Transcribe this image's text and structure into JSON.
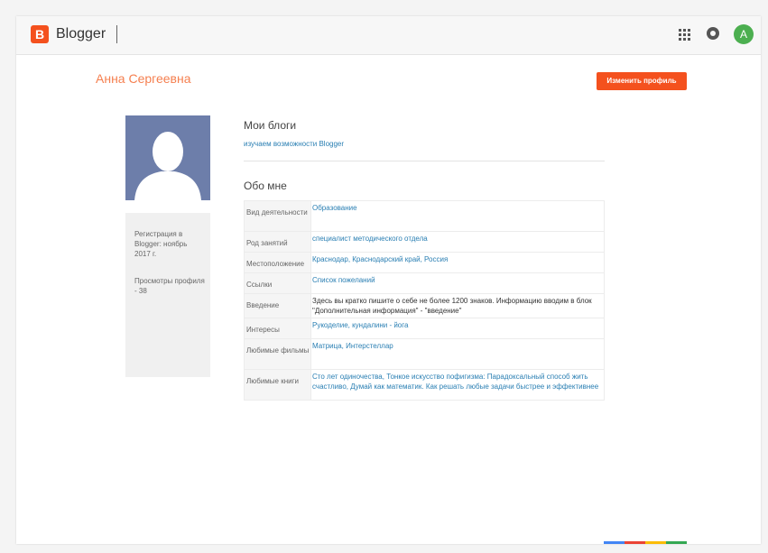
{
  "header": {
    "logo_letter": "B",
    "app_name": "Blogger",
    "avatar_letter": "A",
    "icons": [
      "apps-grid-icon",
      "notifications-icon",
      "account-avatar"
    ],
    "colors": {
      "brand": "#f4511e",
      "avatar": "#4caf50"
    }
  },
  "profile": {
    "name": "Анна Сергеевна",
    "edit_button": "Изменить профиль"
  },
  "sidebar": {
    "registration": "Регистрация в Blogger: ноябрь 2017 г.",
    "views": "Просмотры профиля - 38"
  },
  "my_blogs": {
    "title": "Мои блоги",
    "blogs": [
      "изучаем возможности Blogger"
    ]
  },
  "about": {
    "title": "Обо мне",
    "rows": [
      {
        "label": "Вид деятельности",
        "value": "Образование"
      },
      {
        "label": "Род занятий",
        "value": "специалист методического отдела"
      },
      {
        "label": "Местоположение",
        "value": "Краснодар, Краснодарский край, Россия"
      },
      {
        "label": "Ссылки",
        "value": "Список пожеланий"
      },
      {
        "label": "Введение",
        "value": "Здесь вы кратко пишите о себе не более 1200 знаков. Информацию вводим в блок \"Дополнительная информация\" - \"введение\""
      },
      {
        "label": "Интересы",
        "value": "Рукоделие, кундалини - йога"
      },
      {
        "label": "Любимые фильмы",
        "value": "Матрица, Интерстеллар"
      },
      {
        "label": "Любимые книги",
        "value": "Сто лет одиночества, Тонкое искусство пофигизма: Парадоксальный способ жить счастливо, Думай как математик. Как решать любые задачи быстрее и эффективнее"
      }
    ]
  }
}
